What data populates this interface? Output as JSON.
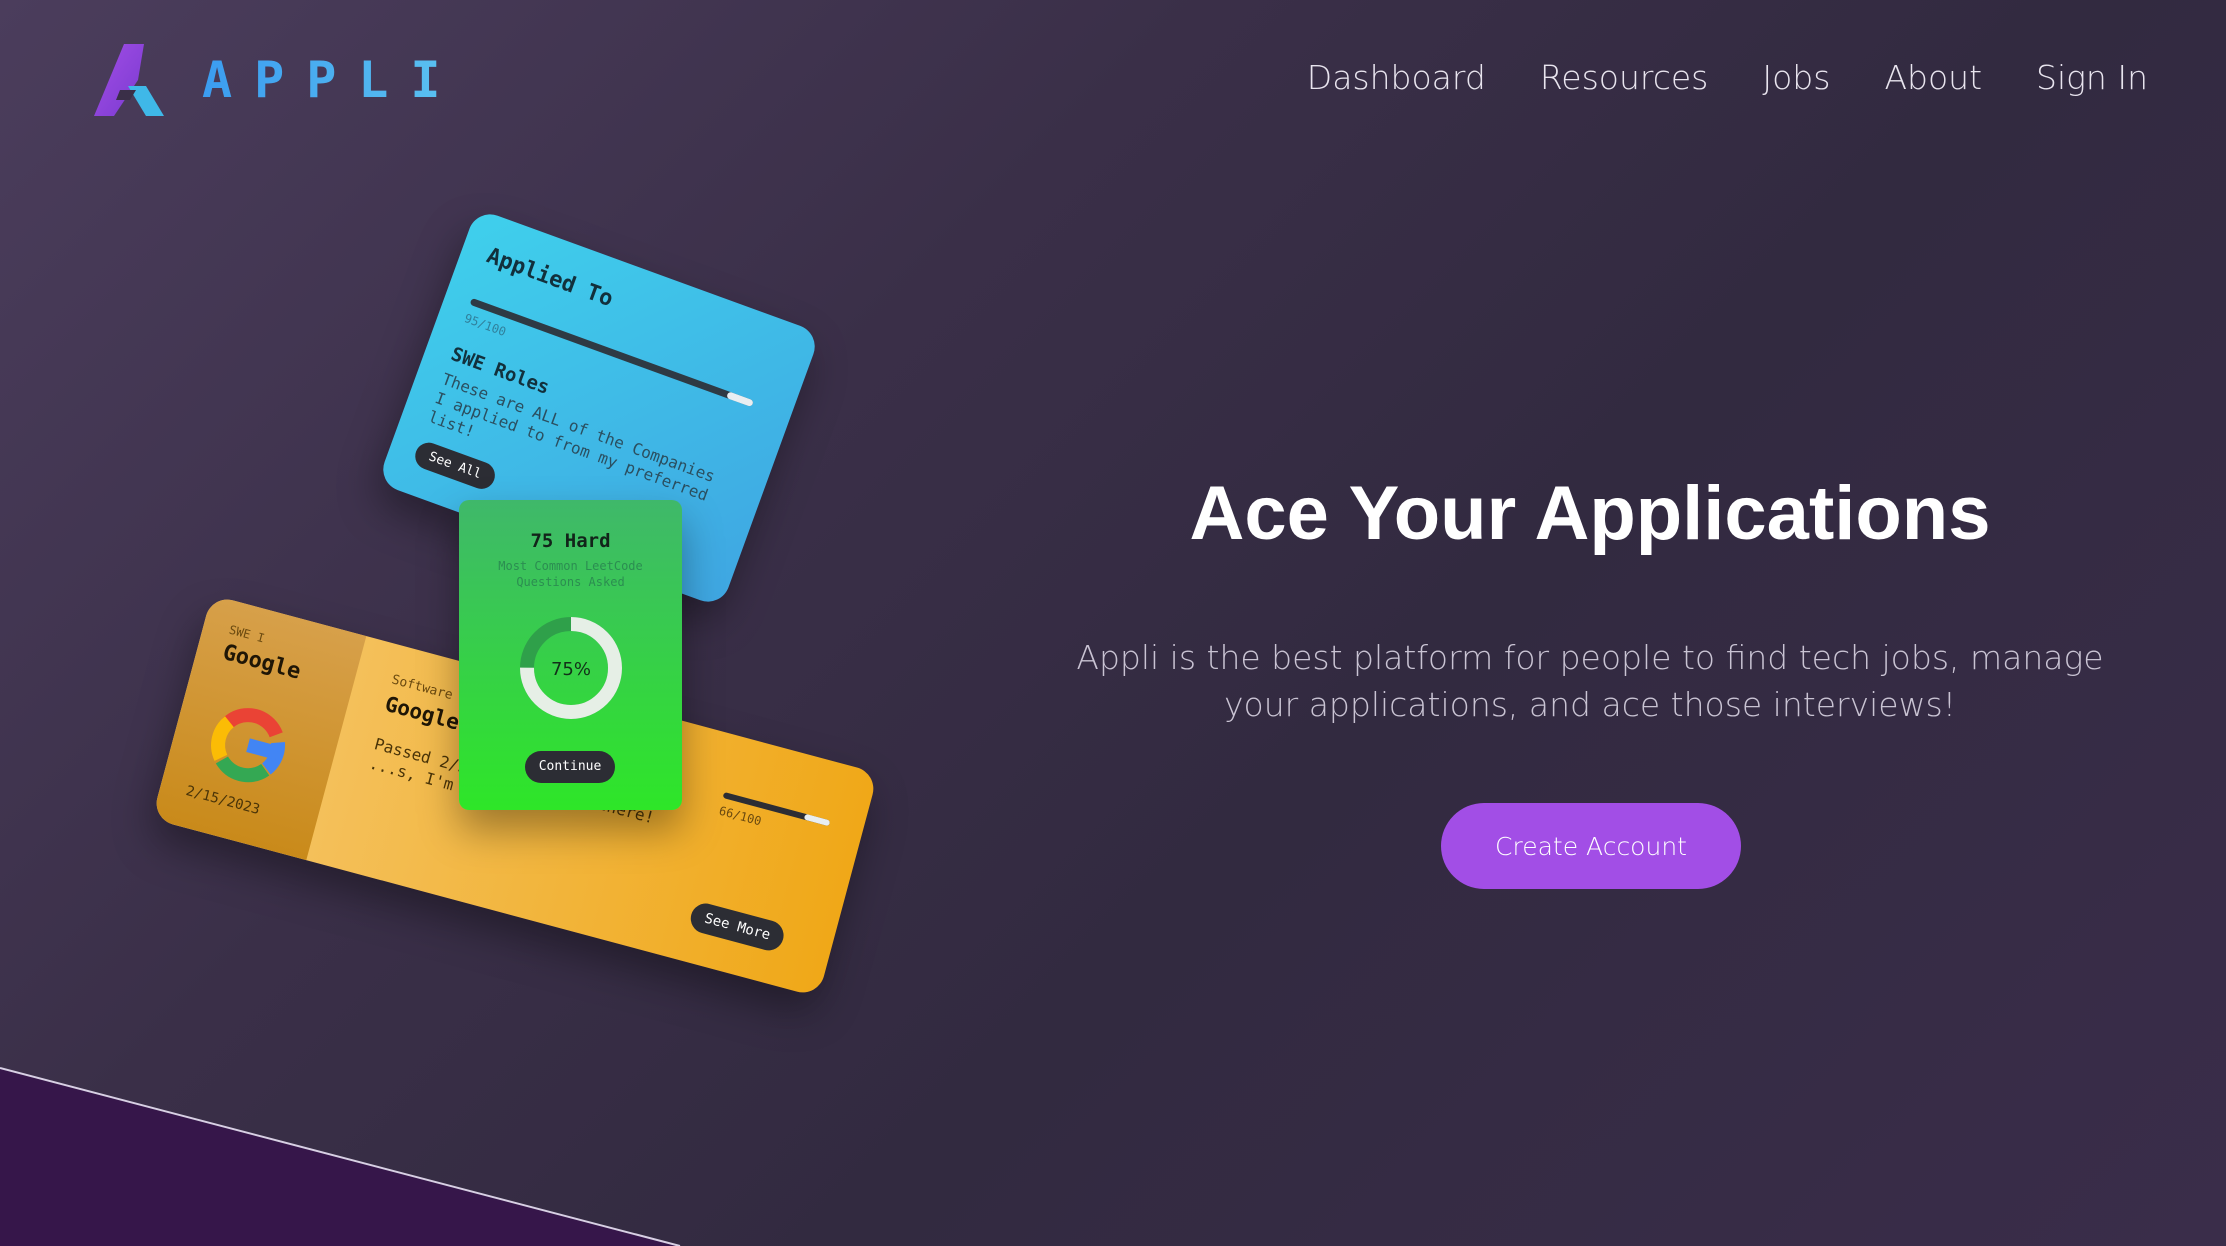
{
  "brand": {
    "name": "APPLI"
  },
  "nav": {
    "items": [
      "Dashboard",
      "Resources",
      "Jobs",
      "About",
      "Sign In"
    ]
  },
  "hero": {
    "title": "Ace Your Applications",
    "subtitle": "Appli is the best platform for people to find tech jobs, manage your applications, and ace those interviews!",
    "cta": "Create Account"
  },
  "cards": {
    "applied": {
      "title": "Applied To",
      "count": "95/100",
      "progress": 0.95,
      "roles": "SWE Roles",
      "description": "These are ALL of the Companies I applied to from my preferred list!",
      "button": "See All"
    },
    "hard": {
      "title": "75 Hard",
      "subtitle": "Most Common LeetCode Questions Asked",
      "percent": "75%",
      "progress": 0.75,
      "button": "Continue"
    },
    "google": {
      "role": "SWE I",
      "company": "Google",
      "date": "2/15/2023",
      "position": "Software Engin",
      "company2": "Google",
      "description": "Passed 2/3 Te... almost there! ...s, I'm",
      "count": "66/100",
      "progress": 0.66,
      "button": "See More"
    }
  },
  "colors": {
    "accent": "#a24ee6",
    "blue_card": "#3fb8e8",
    "green_card": "#2ee628",
    "gold_card": "#f0a818",
    "dark_wedge": "#36164a"
  }
}
